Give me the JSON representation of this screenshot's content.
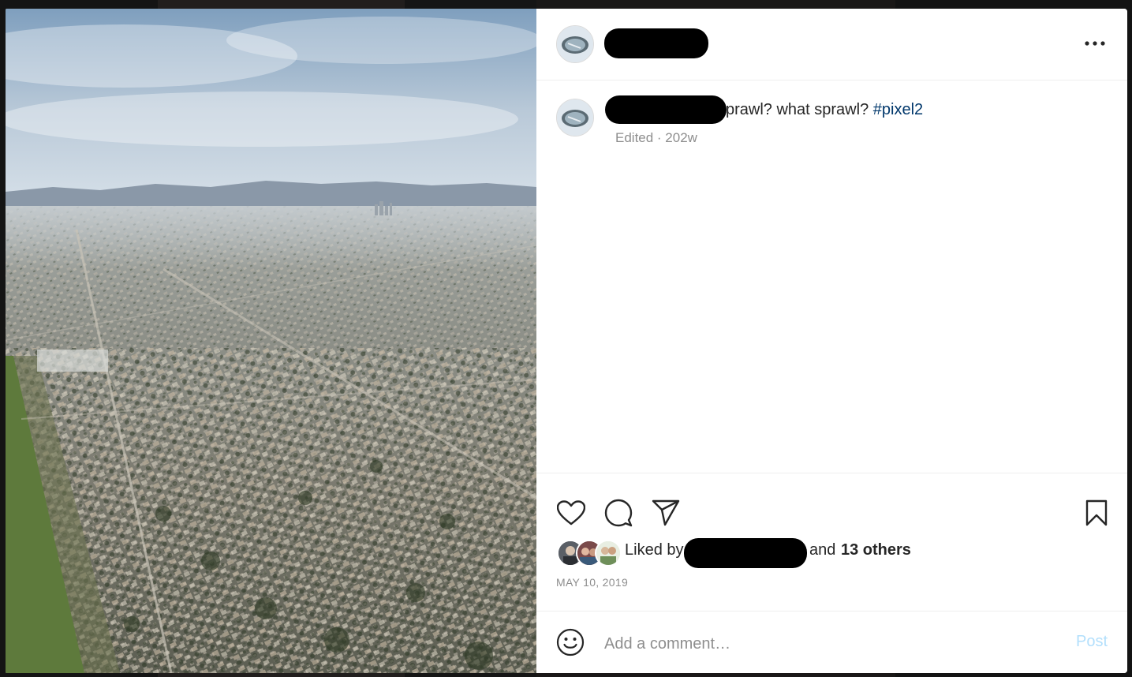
{
  "post": {
    "username": "",
    "caption_text": "prawl? what sprawl?",
    "hashtag": "#pixel2",
    "meta": "Edited · 202w",
    "date": "MAY 10, 2019"
  },
  "likes": {
    "prefix": "Liked by",
    "middle": "and",
    "others": "13 others"
  },
  "comment": {
    "placeholder": "Add a comment…",
    "post_label": "Post"
  },
  "icons": {
    "more": "more-options-icon",
    "like": "heart-icon",
    "comment": "comment-bubble-icon",
    "share": "paper-plane-icon",
    "save": "bookmark-icon",
    "emoji": "smiley-icon"
  },
  "colors": {
    "hashtag": "#00376b",
    "post_button_disabled": "#b2dffc",
    "muted_text": "#8e8e8e"
  }
}
